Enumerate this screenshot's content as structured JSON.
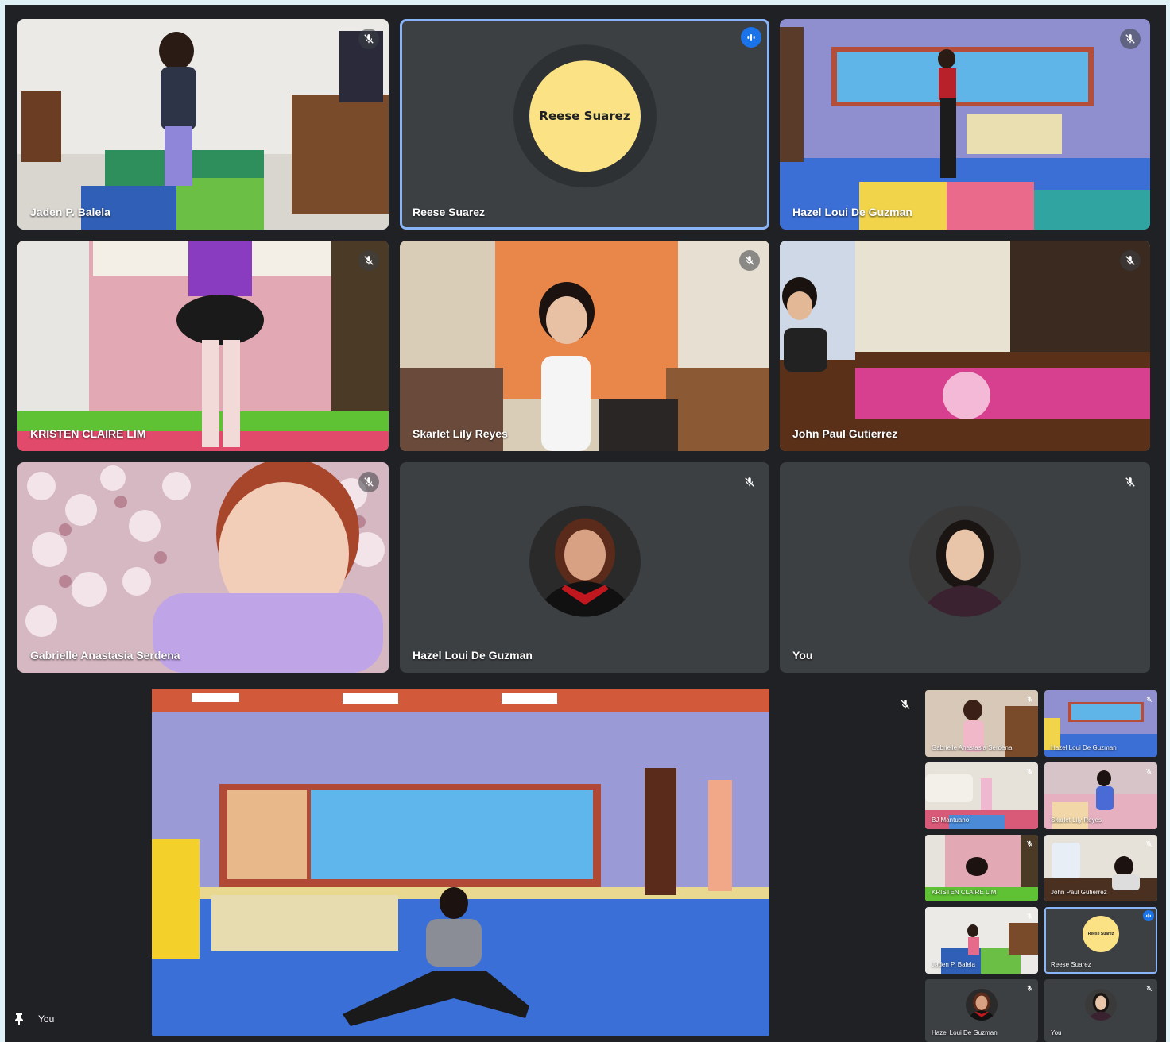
{
  "grid_tiles": [
    {
      "name": "Jaden P. Balela",
      "type": "video",
      "muted": true
    },
    {
      "name": "Reese Suarez",
      "type": "initials",
      "initials_text": "Reese Suarez",
      "speaking": true
    },
    {
      "name": "Hazel Loui De Guzman",
      "type": "video",
      "muted": true
    },
    {
      "name": "KRISTEN CLAIRE LIM",
      "type": "video",
      "muted": true
    },
    {
      "name": "Skarlet Lily Reyes",
      "type": "video",
      "muted": true
    },
    {
      "name": "John Paul Gutierrez",
      "type": "video",
      "muted": true
    },
    {
      "name": "Gabrielle Anastasia Serdena",
      "type": "video",
      "muted": true
    },
    {
      "name": "Hazel Loui De Guzman",
      "type": "avatar",
      "muted": true
    },
    {
      "name": "You",
      "type": "avatar",
      "muted": true
    }
  ],
  "pinned": {
    "label": "You"
  },
  "side_thumbnails": [
    {
      "name": "Gabrielle Anastasia Serdena"
    },
    {
      "name": "Hazel Loui De Guzman"
    },
    {
      "name": "BJ Mantuano"
    },
    {
      "name": "Skarlet Lily Reyes"
    },
    {
      "name": "KRISTEN CLAIRE LIM"
    },
    {
      "name": "John Paul Gutierrez"
    },
    {
      "name": "Jaden P. Balela"
    },
    {
      "name": "Reese Suarez",
      "initials_text": "Reese Suarez"
    },
    {
      "name": "Hazel Loui De Guzman"
    },
    {
      "name": "You"
    }
  ],
  "colors": {
    "panel": "#202124",
    "tile": "#3c4043",
    "speaking_border": "#8ab4f8",
    "initials_bg": "#fbe285",
    "speak_badge": "#1a73e8"
  }
}
